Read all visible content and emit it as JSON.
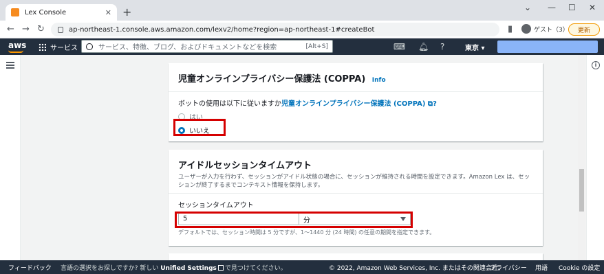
{
  "browser": {
    "tab_title": "Lex Console",
    "tab_close": "✕",
    "new_tab": "+",
    "url": "ap-northeast-1.console.aws.amazon.com/lexv2/home?region=ap-northeast-1#createBot",
    "guest_label": "ゲスト（3）",
    "update_label": "更新"
  },
  "aws_nav": {
    "logo": "aws",
    "services_label": "サービス",
    "search_placeholder": "サービス、特徴、ブログ、およびドキュメントなどを検索",
    "search_shortcut": "[Alt+S]",
    "region": "東京 ▾"
  },
  "coppa": {
    "title": "児童オンラインプライバシー保護法 (COPPA)",
    "info": "Info",
    "question_prefix": "ボットの使用は以下に従いますか",
    "question_link": "児童オンラインプライバシー保護法 (COPPA)",
    "question_suffix": "?",
    "option_yes": "はい",
    "option_no": "いいえ",
    "selected": "いいえ"
  },
  "idle": {
    "title": "アイドルセッションタイムアウト",
    "description": "ユーザーが入力を行わず、セッションがアイドル状態の場合に、セッションが維持される時間を設定できます。Amazon Lex は、セッションが終了するまでコンテキスト情報を保持します。",
    "field_label": "セッションタイムアウト",
    "value": "5",
    "unit": "分",
    "hint": "デフォルトでは、セッション時間は 5 分ですが、1～1440 分 (24 時間) の任意の期間を指定できます。"
  },
  "footer": {
    "feedback": "フィードバック",
    "lang_prompt": "言語の選択をお探しですか? 新しい",
    "unified_settings": "Unified Settings",
    "lang_suffix": "で見つけてください。",
    "copyright": "© 2022, Amazon Web Services, Inc. またはその関連会社。",
    "privacy": "プライバシー",
    "terms": "用語",
    "cookies": "Cookie の設定"
  }
}
